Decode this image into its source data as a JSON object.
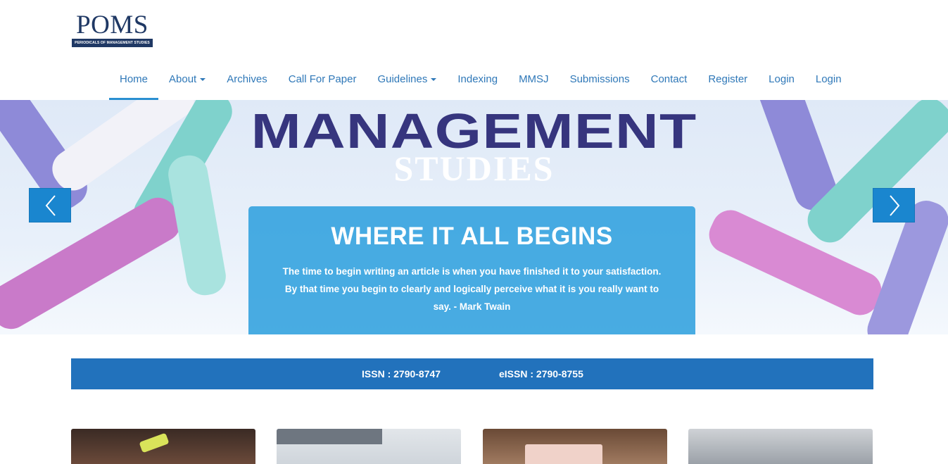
{
  "logo": {
    "title": "POMS",
    "subtitle": "PERIODICALS OF MANAGEMENT STUDIES"
  },
  "nav": {
    "items": [
      {
        "label": "Home",
        "active": true,
        "dropdown": false
      },
      {
        "label": "About",
        "dropdown": true
      },
      {
        "label": "Archives",
        "dropdown": false
      },
      {
        "label": "Call For Paper",
        "dropdown": false
      },
      {
        "label": "Guidelines",
        "dropdown": true
      },
      {
        "label": "Indexing",
        "dropdown": false
      },
      {
        "label": "MMSJ",
        "dropdown": false
      },
      {
        "label": "Submissions",
        "dropdown": false
      },
      {
        "label": "Contact",
        "dropdown": false
      },
      {
        "label": "Register",
        "dropdown": false
      },
      {
        "label": "Login",
        "dropdown": false
      },
      {
        "label": "Login",
        "dropdown": false
      }
    ]
  },
  "hero": {
    "title": "MANAGEMENT",
    "subtitle": "STUDIES",
    "caption_title": "WHERE IT ALL BEGINS",
    "caption_text": "The time to begin writing an article is when you have finished it to your satisfaction. By that time you begin to clearly and logically perceive what it is you really want to say. - Mark Twain",
    "prev_icon": "chevron-left-icon",
    "next_icon": "chevron-right-icon"
  },
  "issn": {
    "print": "ISSN : 2790-8747",
    "online": "eISSN : 2790-8755"
  },
  "colors": {
    "brand": "#1f3864",
    "nav_link": "#2f78b8",
    "accent": "#2272bc",
    "caption_bg": "#30a0de"
  }
}
